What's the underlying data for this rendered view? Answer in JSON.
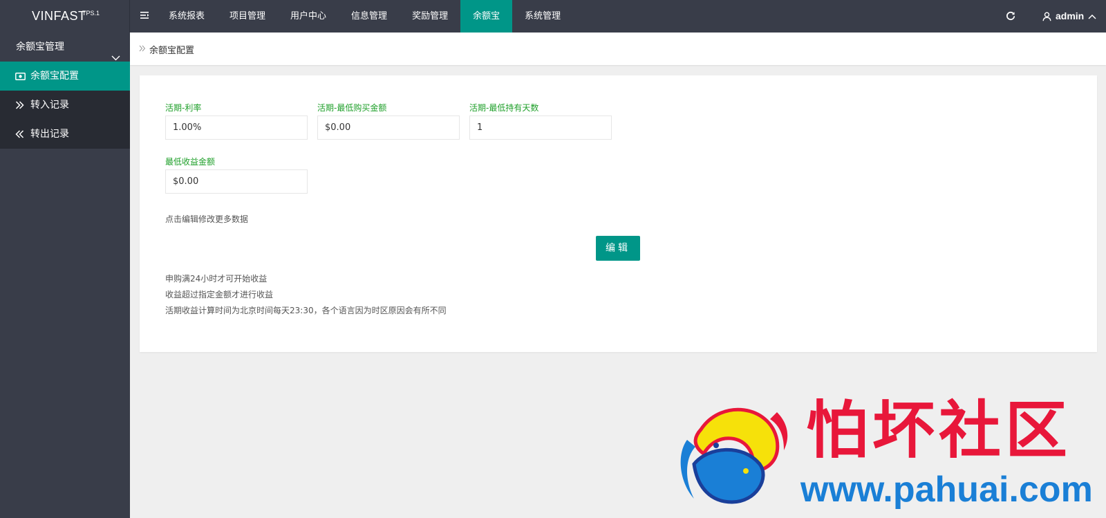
{
  "app": {
    "logo": "VINFAST",
    "logo_sup": "TPS.1"
  },
  "topnav": {
    "items": [
      {
        "label": "系统报表"
      },
      {
        "label": "项目管理"
      },
      {
        "label": "用户中心"
      },
      {
        "label": "信息管理"
      },
      {
        "label": "奖励管理"
      },
      {
        "label": "余额宝",
        "active": true
      },
      {
        "label": "系统管理"
      }
    ]
  },
  "user": {
    "name": "admin"
  },
  "sidebar": {
    "group": "余额宝管理",
    "items": [
      {
        "label": "余额宝配置",
        "icon": "money-icon",
        "active": true
      },
      {
        "label": "转入记录",
        "icon": "double-chevron-right-icon"
      },
      {
        "label": "转出记录",
        "icon": "double-chevron-left-icon"
      }
    ]
  },
  "breadcrumb": {
    "current": "余额宝配置"
  },
  "form": {
    "fields": [
      {
        "label": "活期-利率",
        "value": "1.00%"
      },
      {
        "label": "活期-最低购买金额",
        "value": "$0.00"
      },
      {
        "label": "活期-最低持有天数",
        "value": "1"
      },
      {
        "label": "最低收益金额",
        "value": "$0.00"
      }
    ],
    "hint": "点击编辑修改更多数据",
    "edit_label": "编辑",
    "notes": [
      "申购满24小时才可开始收益",
      "收益超过指定金额才进行收益",
      "活期收益计算时间为北京时间每天23:30，各个语言因为时区原因会有所不同"
    ]
  },
  "watermark": {
    "title": "怕坏社区",
    "url": "www.pahuai.com"
  },
  "colors": {
    "header_bg": "#393d49",
    "accent": "#009688",
    "label_green": "#1e9f29",
    "watermark_red": "#e8173a",
    "watermark_blue": "#1a7fd6"
  }
}
